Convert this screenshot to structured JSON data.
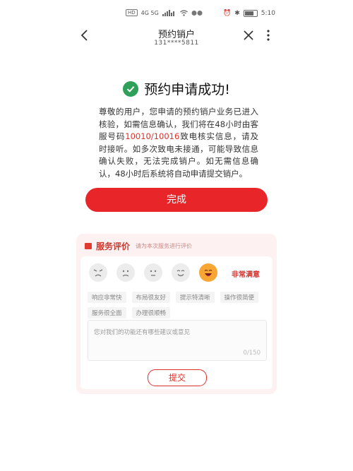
{
  "status_bar": {
    "left_chips": [
      "HD",
      "HD"
    ],
    "left_text": "4G 5G",
    "time": "5:10"
  },
  "nav": {
    "title": "预约销户",
    "subtitle": "131****5811"
  },
  "success": {
    "title": "预约申请成功!",
    "notice_part1": "尊敬的用户，您申请的预约销户业务已进入核验，如需信息确认，我们将在48小时由客服号码",
    "notice_phone": "10010/10016",
    "notice_part2": "致电核实信息，请及时接听。如多次致电未接通，可能导致信息确认失败，无法完成销户。如无需信息确认，48小时后系统将自动申请提交销户。",
    "done_label": "完成"
  },
  "rating": {
    "title": "服务评价",
    "hint": "请为本次服务进行评价",
    "faces": [
      "angry-face-icon",
      "sad-face-icon",
      "neutral-face-icon",
      "smile-face-icon",
      "grin-face-icon"
    ],
    "selected_index": 4,
    "selected_label": "非常满意",
    "tags": [
      "响应非常快",
      "布局很友好",
      "提示特清晰",
      "操作很简便",
      "服务很全面",
      "办理很顺畅"
    ],
    "feedback_placeholder": "您对我们的功能还有哪些建议或意见",
    "feedback_count": "0/150",
    "submit_label": "提交"
  }
}
